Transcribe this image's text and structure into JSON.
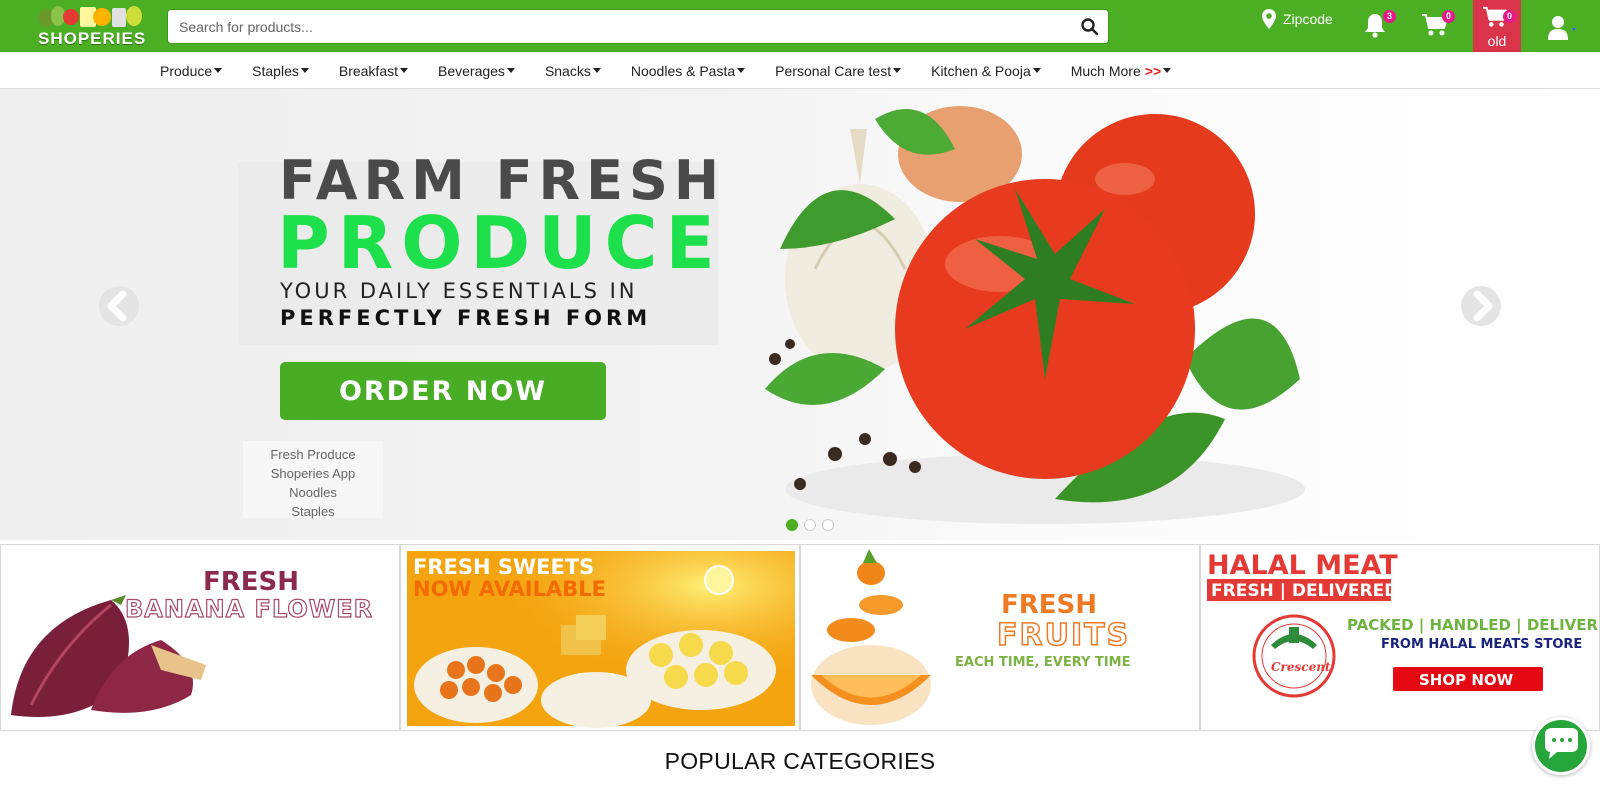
{
  "brand": {
    "name": "SHOPERIES",
    "accent": "#4caf23",
    "alert": "#d9344a",
    "badge_color": "#e6198c"
  },
  "header": {
    "search": {
      "placeholder": "Search for products...",
      "icon": "search-icon"
    },
    "zipcode_label": "Zipcode",
    "notifications_count": "3",
    "cart_count": "0",
    "old_cart": {
      "count": "0",
      "label": "old"
    }
  },
  "nav": {
    "items": [
      {
        "label": "Produce"
      },
      {
        "label": "Staples"
      },
      {
        "label": "Breakfast"
      },
      {
        "label": "Beverages"
      },
      {
        "label": "Snacks"
      },
      {
        "label": "Noodles & Pasta"
      },
      {
        "label": "Personal Care test"
      },
      {
        "label": "Kitchen & Pooja"
      }
    ],
    "more_label": "Much More",
    "more_accent": ">>"
  },
  "hero": {
    "line1": "FARM FRESH",
    "line2": "PRODUCE",
    "line3": "YOUR DAILY ESSENTIALS IN",
    "line4": "PERFECTLY FRESH FORM",
    "cta": "ORDER NOW",
    "links": [
      "Fresh Produce",
      "Shoperies App",
      "Noodles",
      "Staples"
    ],
    "slide_count": 3,
    "active_slide": 1
  },
  "banners": [
    {
      "line1": "FRESH",
      "line2": "BANANA FLOWER"
    },
    {
      "line1": "FRESH SWEETS",
      "line2": "NOW AVAILABLE"
    },
    {
      "line1": "FRESH",
      "line2": "FRUITS",
      "line3": "EACH TIME, EVERY TIME"
    },
    {
      "line1": "HALAL MEAT",
      "line2": "FRESH | DELIVERED",
      "line3": "PACKED | HANDLED | DELIVERED",
      "line4": "FROM HALAL MEATS STORE",
      "cta": "SHOP NOW",
      "logo_text": "Crescent"
    }
  ],
  "popular_title": "POPULAR CATEGORIES"
}
